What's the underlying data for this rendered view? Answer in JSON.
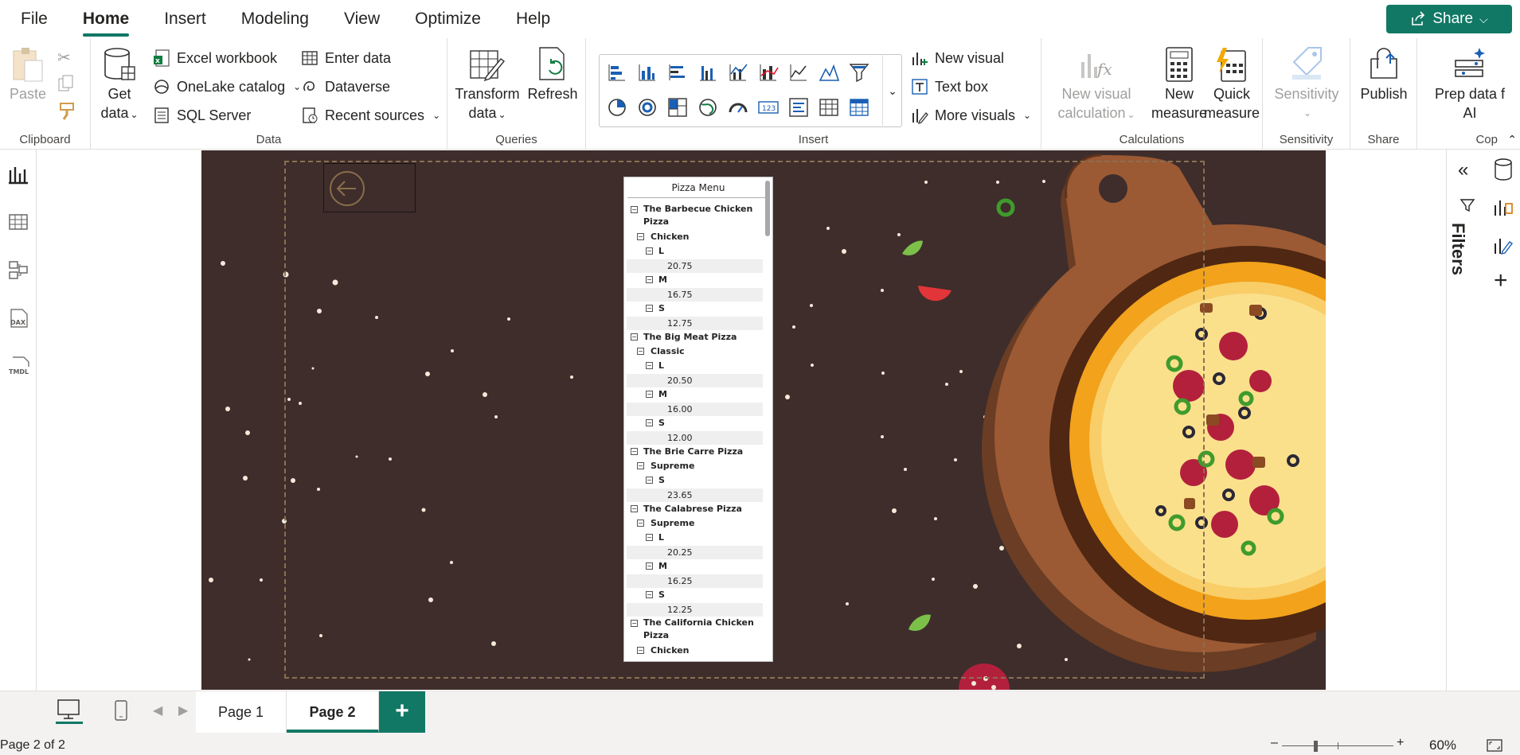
{
  "menu": {
    "tabs": [
      "File",
      "Home",
      "Insert",
      "Modeling",
      "View",
      "Optimize",
      "Help"
    ],
    "active": "Home",
    "share_label": "Share"
  },
  "ribbon": {
    "clipboard": {
      "label": "Clipboard",
      "paste": "Paste"
    },
    "data": {
      "label": "Data",
      "get_data": [
        "Get",
        "data"
      ],
      "excel": "Excel workbook",
      "onelake": "OneLake catalog",
      "sql": "SQL Server",
      "enter": "Enter data",
      "dataverse": "Dataverse",
      "recent": "Recent sources"
    },
    "queries": {
      "label": "Queries",
      "transform": [
        "Transform",
        "data"
      ],
      "refresh": "Refresh"
    },
    "insert": {
      "label": "Insert",
      "new_visual": "New visual",
      "text_box": "Text box",
      "more_visuals": "More visuals"
    },
    "calculations": {
      "label": "Calculations",
      "new_visual_calc": [
        "New visual",
        "calculation"
      ],
      "new_measure": [
        "New",
        "measure"
      ],
      "quick_measure": [
        "Quick",
        "measure"
      ]
    },
    "sensitivity": {
      "label": "Sensitivity",
      "btn": "Sensitivity"
    },
    "share": {
      "label": "Share",
      "publish": "Publish"
    },
    "copilot": {
      "label": "Cop",
      "prep": [
        "Prep data f",
        "AI"
      ]
    }
  },
  "matrix": {
    "title": "Pizza Menu",
    "rows": [
      {
        "level": 0,
        "text": "The Barbecue Chicken Pizza",
        "wrap": true
      },
      {
        "level": 1,
        "text": "Chicken"
      },
      {
        "level": 2,
        "text": "L"
      },
      {
        "value": "20.75"
      },
      {
        "level": 2,
        "text": "M"
      },
      {
        "value": "16.75"
      },
      {
        "level": 2,
        "text": "S"
      },
      {
        "value": "12.75"
      },
      {
        "level": 0,
        "text": "The Big Meat Pizza"
      },
      {
        "level": 1,
        "text": "Classic"
      },
      {
        "level": 2,
        "text": "L"
      },
      {
        "value": "20.50"
      },
      {
        "level": 2,
        "text": "M"
      },
      {
        "value": "16.00"
      },
      {
        "level": 2,
        "text": "S"
      },
      {
        "value": "12.00"
      },
      {
        "level": 0,
        "text": "The Brie Carre Pizza"
      },
      {
        "level": 1,
        "text": "Supreme"
      },
      {
        "level": 2,
        "text": "S"
      },
      {
        "value": "23.65"
      },
      {
        "level": 0,
        "text": "The Calabrese Pizza"
      },
      {
        "level": 1,
        "text": "Supreme"
      },
      {
        "level": 2,
        "text": "L"
      },
      {
        "value": "20.25"
      },
      {
        "level": 2,
        "text": "M"
      },
      {
        "value": "16.25"
      },
      {
        "level": 2,
        "text": "S"
      },
      {
        "value": "12.25"
      },
      {
        "level": 0,
        "text": "The California Chicken Pizza",
        "wrap": true
      },
      {
        "level": 1,
        "text": "Chicken"
      }
    ]
  },
  "filters": {
    "label": "Filters"
  },
  "pages": {
    "tabs": [
      "Page 1",
      "Page 2"
    ],
    "active": "Page 2",
    "add": "+"
  },
  "status": {
    "page_info": "Page 2 of 2",
    "zoom": "60%",
    "zoom_level": 0.6
  },
  "colors": {
    "accent": "#117865",
    "report_bg": "#3e2d2b"
  }
}
